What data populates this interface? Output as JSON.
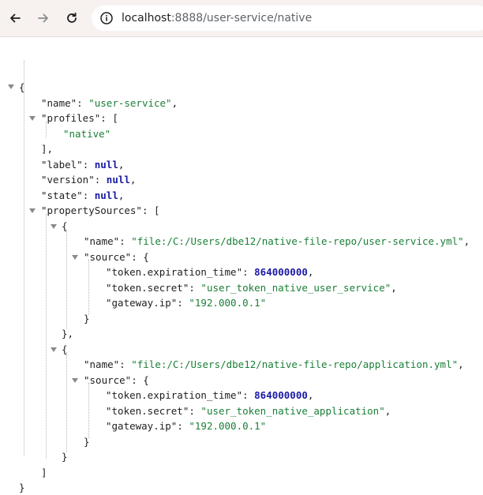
{
  "browser": {
    "url_host": "localhost",
    "url_path": ":8888/user-service/native",
    "icons": {
      "back": "arrow-left-icon",
      "forward": "arrow-right-icon",
      "reload": "reload-icon",
      "site": "site-info-icon"
    }
  },
  "json": {
    "open_brace": "{",
    "name_key": "\"name\"",
    "name_val": "\"user-service\"",
    "profiles_key": "\"profiles\"",
    "profiles_val": "\"native\"",
    "label_key": "\"label\"",
    "version_key": "\"version\"",
    "state_key": "\"state\"",
    "null_val": "null",
    "propertySources_key": "\"propertySources\"",
    "sources": [
      {
        "name_key": "\"name\"",
        "name_val": "\"file:/C:/Users/dbe12/native-file-repo/user-service.yml\"",
        "source_key": "\"source\"",
        "exp_key": "\"token.expiration_time\"",
        "exp_val": "864000000",
        "secret_key": "\"token.secret\"",
        "secret_val": "\"user_token_native_user_service\"",
        "ip_key": "\"gateway.ip\"",
        "ip_val": "\"192.000.0.1\""
      },
      {
        "name_key": "\"name\"",
        "name_val": "\"file:/C:/Users/dbe12/native-file-repo/application.yml\"",
        "source_key": "\"source\"",
        "exp_key": "\"token.expiration_time\"",
        "exp_val": "864000000",
        "secret_key": "\"token.secret\"",
        "secret_val": "\"user_token_native_application\"",
        "ip_key": "\"gateway.ip\"",
        "ip_val": "\"192.000.0.1\""
      }
    ]
  }
}
